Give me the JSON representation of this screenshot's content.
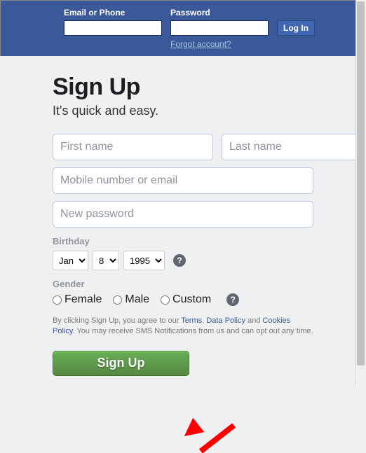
{
  "login": {
    "email_label": "Email or Phone",
    "password_label": "Password",
    "forgot": "Forgot account?",
    "button": "Log In"
  },
  "signup": {
    "heading": "Sign Up",
    "sub": "It's quick and easy.",
    "first_name_ph": "First name",
    "last_name_ph": "Last name",
    "contact_ph": "Mobile number or email",
    "password_ph": "New password",
    "birthday_label": "Birthday",
    "month": "Jan",
    "day": "8",
    "year": "1995",
    "gender_label": "Gender",
    "gender_female": "Female",
    "gender_male": "Male",
    "gender_custom": "Custom",
    "disclaimer_pre": "By clicking Sign Up, you agree to our ",
    "terms": "Terms",
    "sep1": ", ",
    "data_policy": "Data Policy",
    "sep2": " and ",
    "cookies": "Cookies Policy",
    "disclaimer_post": ". You may receive SMS Notifications from us and can opt out any time.",
    "button": "Sign Up",
    "help": "?"
  }
}
